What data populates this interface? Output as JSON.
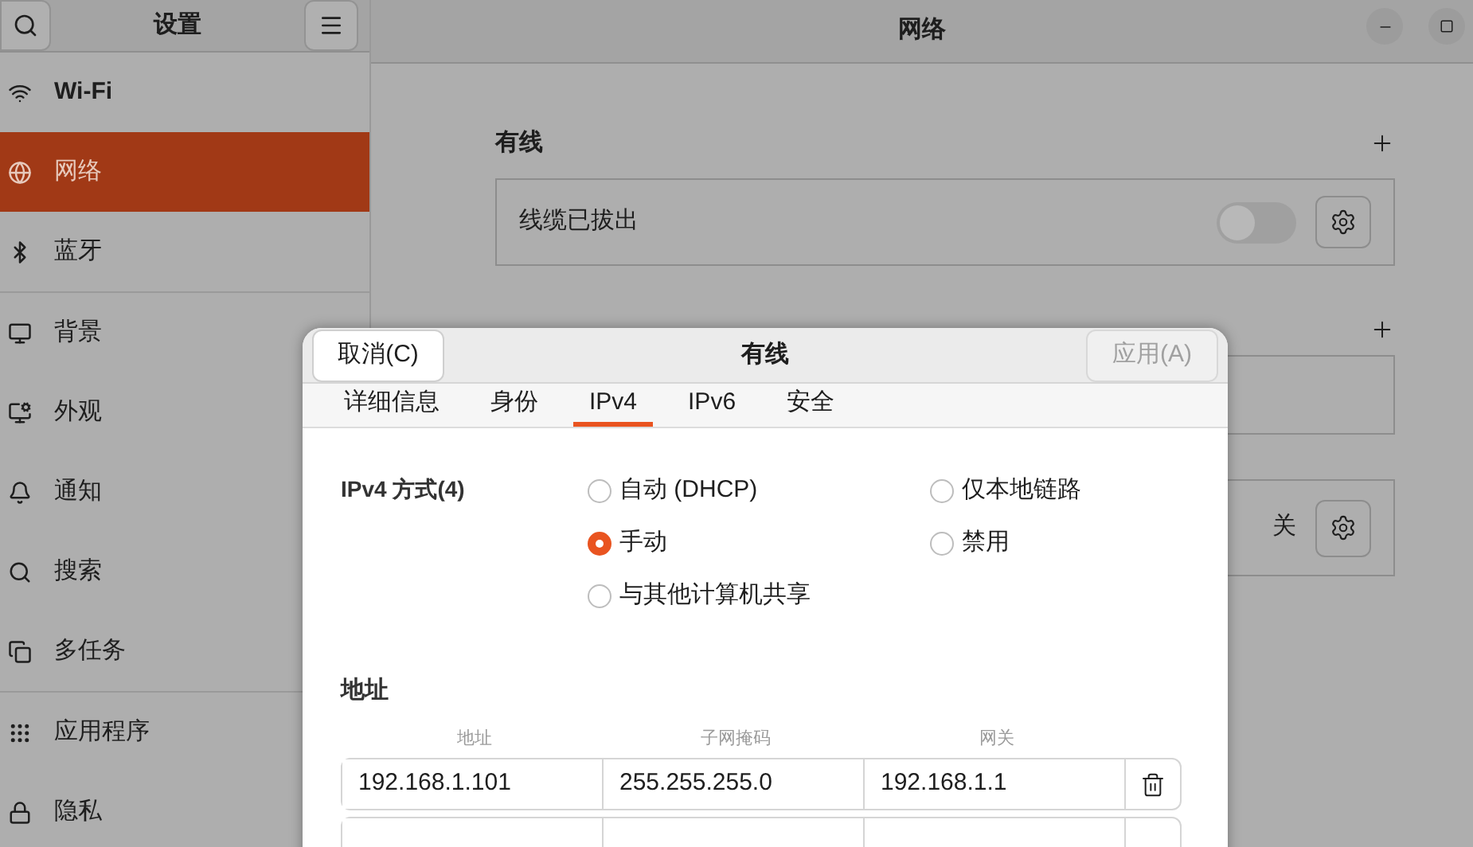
{
  "sidebar": {
    "title": "设置",
    "items": [
      {
        "label": "Wi-Fi",
        "selected": false
      },
      {
        "label": "网络",
        "selected": true
      },
      {
        "label": "蓝牙",
        "selected": false
      },
      {
        "label": "背景",
        "selected": false
      },
      {
        "label": "外观",
        "selected": false
      },
      {
        "label": "通知",
        "selected": false
      },
      {
        "label": "搜索",
        "selected": false
      },
      {
        "label": "多任务",
        "selected": false
      },
      {
        "label": "应用程序",
        "selected": false
      },
      {
        "label": "隐私",
        "selected": false
      }
    ]
  },
  "main": {
    "title": "网络",
    "wired": {
      "heading": "有线",
      "status": "线缆已拔出",
      "on": false
    },
    "proxy": {
      "status": "关"
    }
  },
  "dialog": {
    "title": "有线",
    "cancel": "取消(C)",
    "apply": "应用(A)",
    "apply_disabled": true,
    "tabs": [
      {
        "label": "详细信息",
        "selected": false
      },
      {
        "label": "身份",
        "selected": false
      },
      {
        "label": "IPv4",
        "selected": true
      },
      {
        "label": "IPv6",
        "selected": false
      },
      {
        "label": "安全",
        "selected": false
      }
    ],
    "method_label": "IPv4 方式(4)",
    "methods": [
      {
        "label": "自动 (DHCP)",
        "selected": false
      },
      {
        "label": "仅本地链路",
        "selected": false
      },
      {
        "label": "手动",
        "selected": true
      },
      {
        "label": "禁用",
        "selected": false
      },
      {
        "label": "与其他计算机共享",
        "selected": false
      }
    ],
    "address_heading": "地址",
    "columns": [
      "地址",
      "子网掩码",
      "网关"
    ],
    "rows": [
      {
        "address": "192.168.1.101",
        "netmask": "255.255.255.0",
        "gateway": "192.168.1.1"
      }
    ]
  }
}
